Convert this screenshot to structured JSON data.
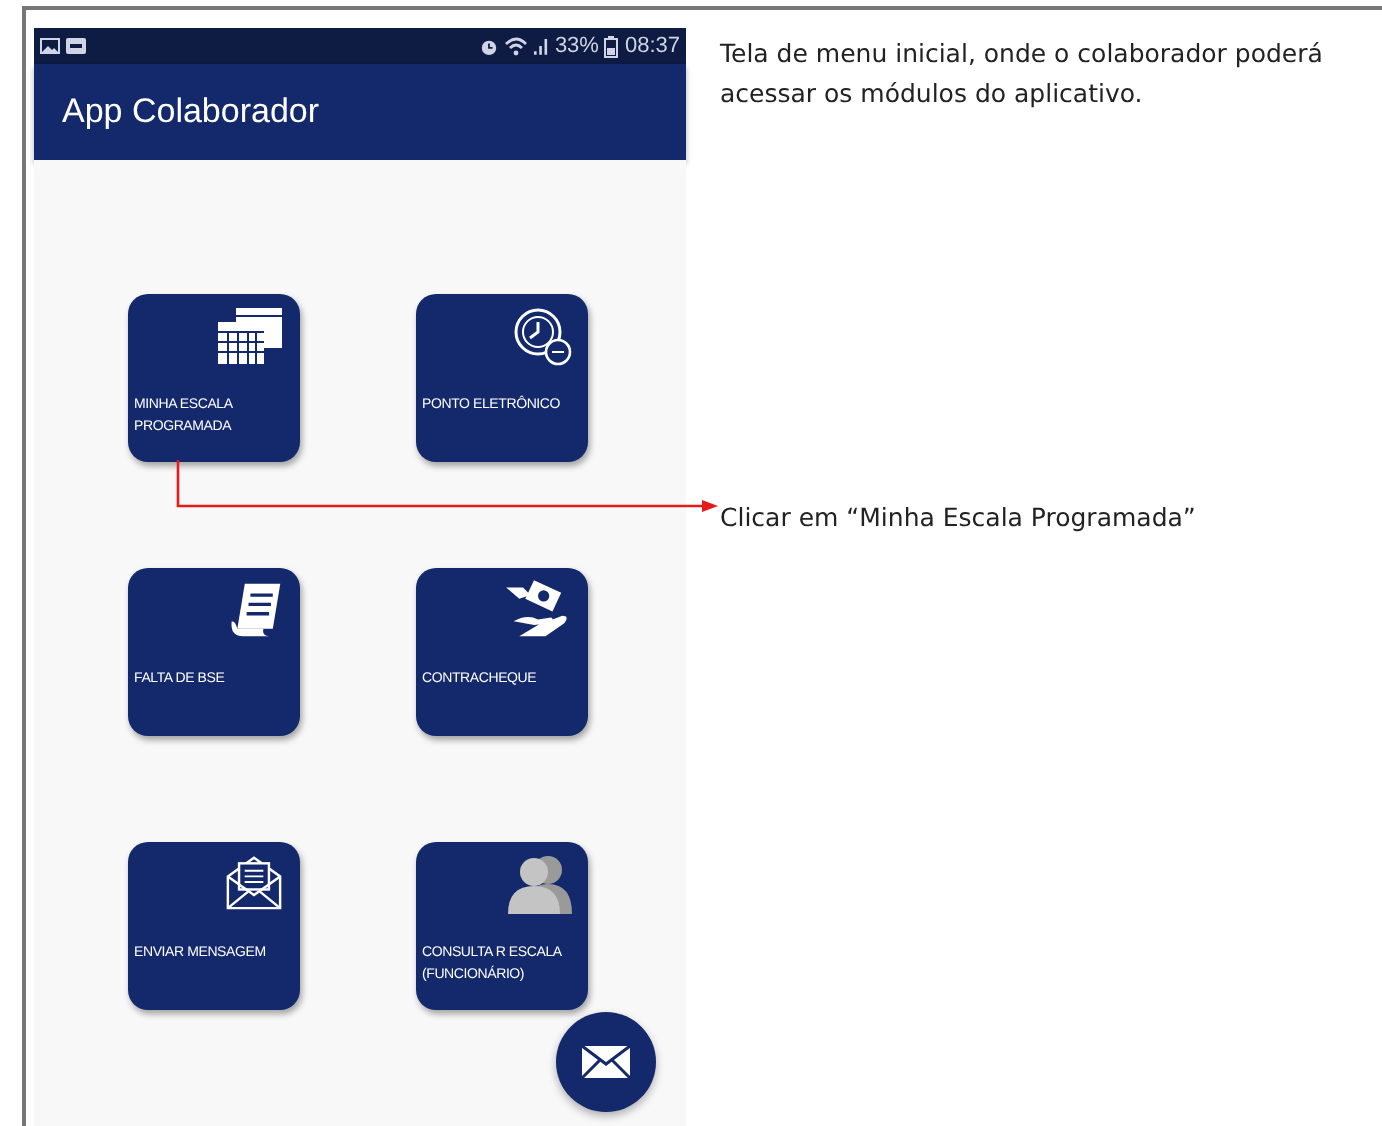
{
  "status_bar": {
    "battery": "33%",
    "time": "08:37"
  },
  "app_bar": {
    "title": "App Colaborador"
  },
  "menu_tiles": [
    {
      "kind": "calendar",
      "lines": [
        "MINHA ESCALA",
        "PROGRAMADA"
      ]
    },
    {
      "kind": "clock",
      "lines": [
        "PONTO ELETRÔNICO"
      ]
    },
    {
      "kind": "document",
      "lines": [
        "FALTA DE BSE"
      ]
    },
    {
      "kind": "money",
      "lines": [
        "CONTRACHEQUE"
      ]
    },
    {
      "kind": "envelope",
      "lines": [
        "ENVIAR MENSAGEM"
      ]
    },
    {
      "kind": "people",
      "lines": [
        "CONSULTA R ESCALA",
        "(FUNCIONÁRIO)"
      ]
    }
  ],
  "annotations": [
    {
      "text": "Tela de menu inicial,  onde o colaborador poderá acessar os módulos do aplicativo."
    },
    {
      "text": "Clicar em “Minha Escala Programada”"
    }
  ]
}
